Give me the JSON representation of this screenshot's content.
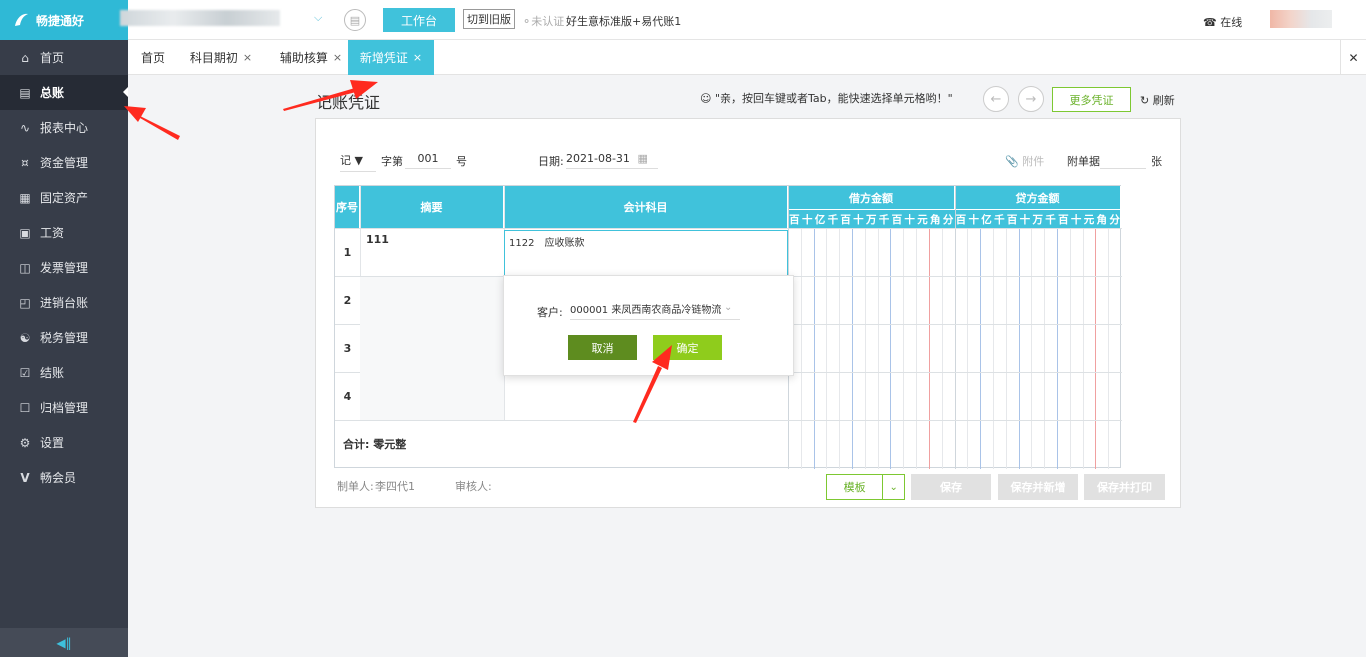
{
  "topbar": {
    "logo_text": "畅捷通好",
    "workbench_label": "工作台",
    "old_version_label": "切到旧版",
    "auth_status": "未认证",
    "company_name": "好生意标准版+易代账1",
    "online_label": "在线"
  },
  "sidebar": {
    "items": [
      {
        "label": "首页",
        "icon": "home-icon"
      },
      {
        "label": "总账",
        "icon": "ledger-icon"
      },
      {
        "label": "报表中心",
        "icon": "chart-icon"
      },
      {
        "label": "资金管理",
        "icon": "money-icon"
      },
      {
        "label": "固定资产",
        "icon": "asset-icon"
      },
      {
        "label": "工资",
        "icon": "salary-icon"
      },
      {
        "label": "发票管理",
        "icon": "invoice-icon"
      },
      {
        "label": "进销台账",
        "icon": "inventory-icon"
      },
      {
        "label": "税务管理",
        "icon": "tax-icon"
      },
      {
        "label": "结账",
        "icon": "close-books-icon"
      },
      {
        "label": "归档管理",
        "icon": "archive-icon"
      },
      {
        "label": "设置",
        "icon": "gear-icon"
      },
      {
        "label": "畅会员",
        "icon": "member-icon"
      }
    ],
    "active_index": 1
  },
  "tabs": [
    {
      "label": "首页"
    },
    {
      "label": "科目期初"
    },
    {
      "label": "辅助核算"
    },
    {
      "label": "新增凭证"
    }
  ],
  "voucher": {
    "title": "记账凭证",
    "hint": "亲，按回车键或者Tab，能快速选择单元格哟！",
    "more_label": "更多凭证",
    "refresh_label": "刷新",
    "type_value": "记",
    "zi_label": "字第",
    "number_value": "001",
    "hao_label": "号",
    "date_label": "日期:",
    "date_value": "2021-08-31",
    "attachment_label": "附件",
    "attach_docs_label": "附单据",
    "attach_unit": "张",
    "header": {
      "seq": "序号",
      "summary": "摘要",
      "account": "会计科目",
      "debit": "借方金额",
      "credit": "贷方金额"
    },
    "digits": [
      "百",
      "十",
      "亿",
      "千",
      "百",
      "十",
      "万",
      "千",
      "百",
      "十",
      "元",
      "角",
      "分"
    ],
    "rows": [
      {
        "seq": "1",
        "summary": "111",
        "account": "1122　应收账款"
      },
      {
        "seq": "2",
        "summary": "",
        "account": ""
      },
      {
        "seq": "3",
        "summary": "",
        "account": ""
      },
      {
        "seq": "4",
        "summary": "",
        "account": ""
      }
    ],
    "total_label": "合计:",
    "total_value": "零元整",
    "maker_label": "制单人:",
    "maker_value": "李四代1",
    "reviewer_label": "审核人:",
    "template_label": "模板",
    "save_label": "保存",
    "save_new_label": "保存并新增",
    "save_print_label": "保存并打印"
  },
  "popup": {
    "customer_label": "客户:",
    "customer_value": "000001 来凤西南农商品冷链物流",
    "cancel_label": "取消",
    "ok_label": "确定"
  },
  "colors": {
    "brand": "#40c2db",
    "sidebar": "#373d49",
    "sidebar_active": "#262b35",
    "green_dark": "#5e8c1f",
    "green_light": "#8fcc1c",
    "arrow": "#ff2a1f"
  }
}
